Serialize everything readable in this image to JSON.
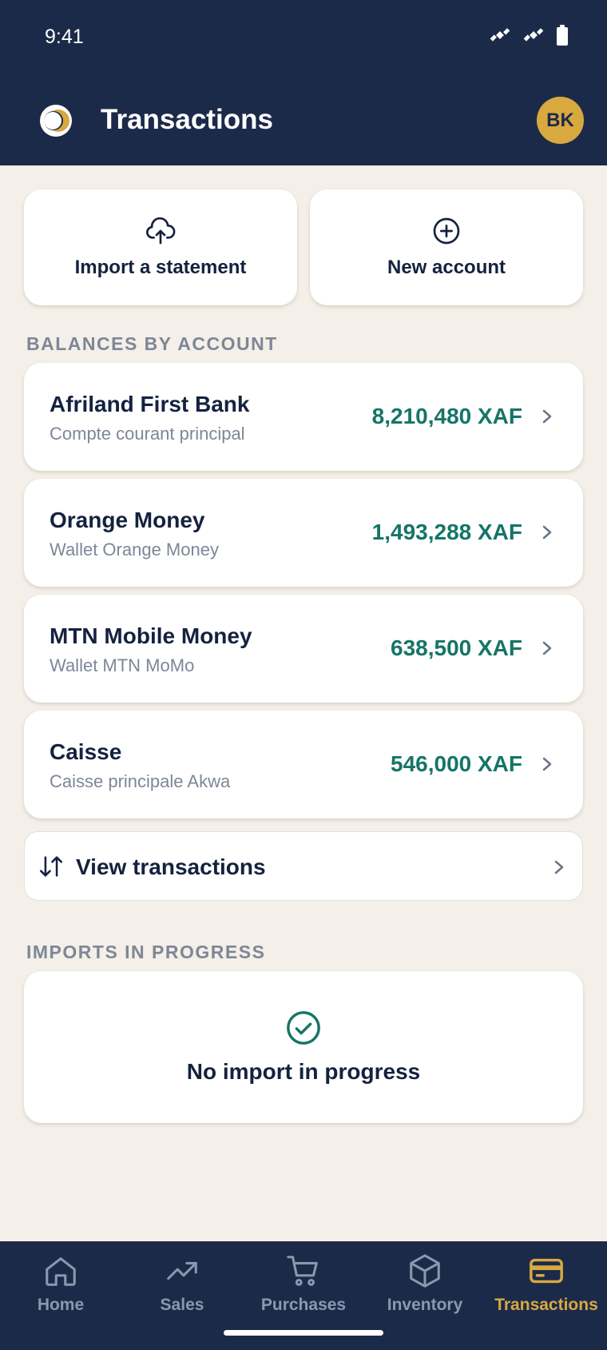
{
  "status_bar": {
    "time": "9:41"
  },
  "header": {
    "title": "Transactions",
    "avatar_initials": "BK"
  },
  "actions": {
    "import_label": "Import a statement",
    "new_account_label": "New account"
  },
  "balances": {
    "heading": "BALANCES BY ACCOUNT",
    "accounts": [
      {
        "name": "Afriland First Bank",
        "description": "Compte courant principal",
        "balance": "8,210,480 XAF"
      },
      {
        "name": "Orange Money",
        "description": "Wallet Orange Money",
        "balance": "1,493,288 XAF"
      },
      {
        "name": "MTN Mobile Money",
        "description": "Wallet MTN MoMo",
        "balance": "638,500 XAF"
      },
      {
        "name": "Caisse",
        "description": "Caisse principale Akwa",
        "balance": "546,000 XAF"
      }
    ]
  },
  "view_transactions": {
    "label": "View transactions"
  },
  "imports": {
    "heading": "IMPORTS IN PROGRESS",
    "empty_text": "No import in progress"
  },
  "nav": {
    "items": [
      {
        "label": "Home",
        "icon": "home-icon"
      },
      {
        "label": "Sales",
        "icon": "trending-up-icon"
      },
      {
        "label": "Purchases",
        "icon": "cart-icon"
      },
      {
        "label": "Inventory",
        "icon": "box-icon"
      },
      {
        "label": "Transactions",
        "icon": "card-icon"
      }
    ],
    "active": "Transactions"
  },
  "colors": {
    "navy": "#1c2a4a",
    "accent": "#d8a93f",
    "balance_green": "#157567",
    "background": "#f4efe8"
  }
}
